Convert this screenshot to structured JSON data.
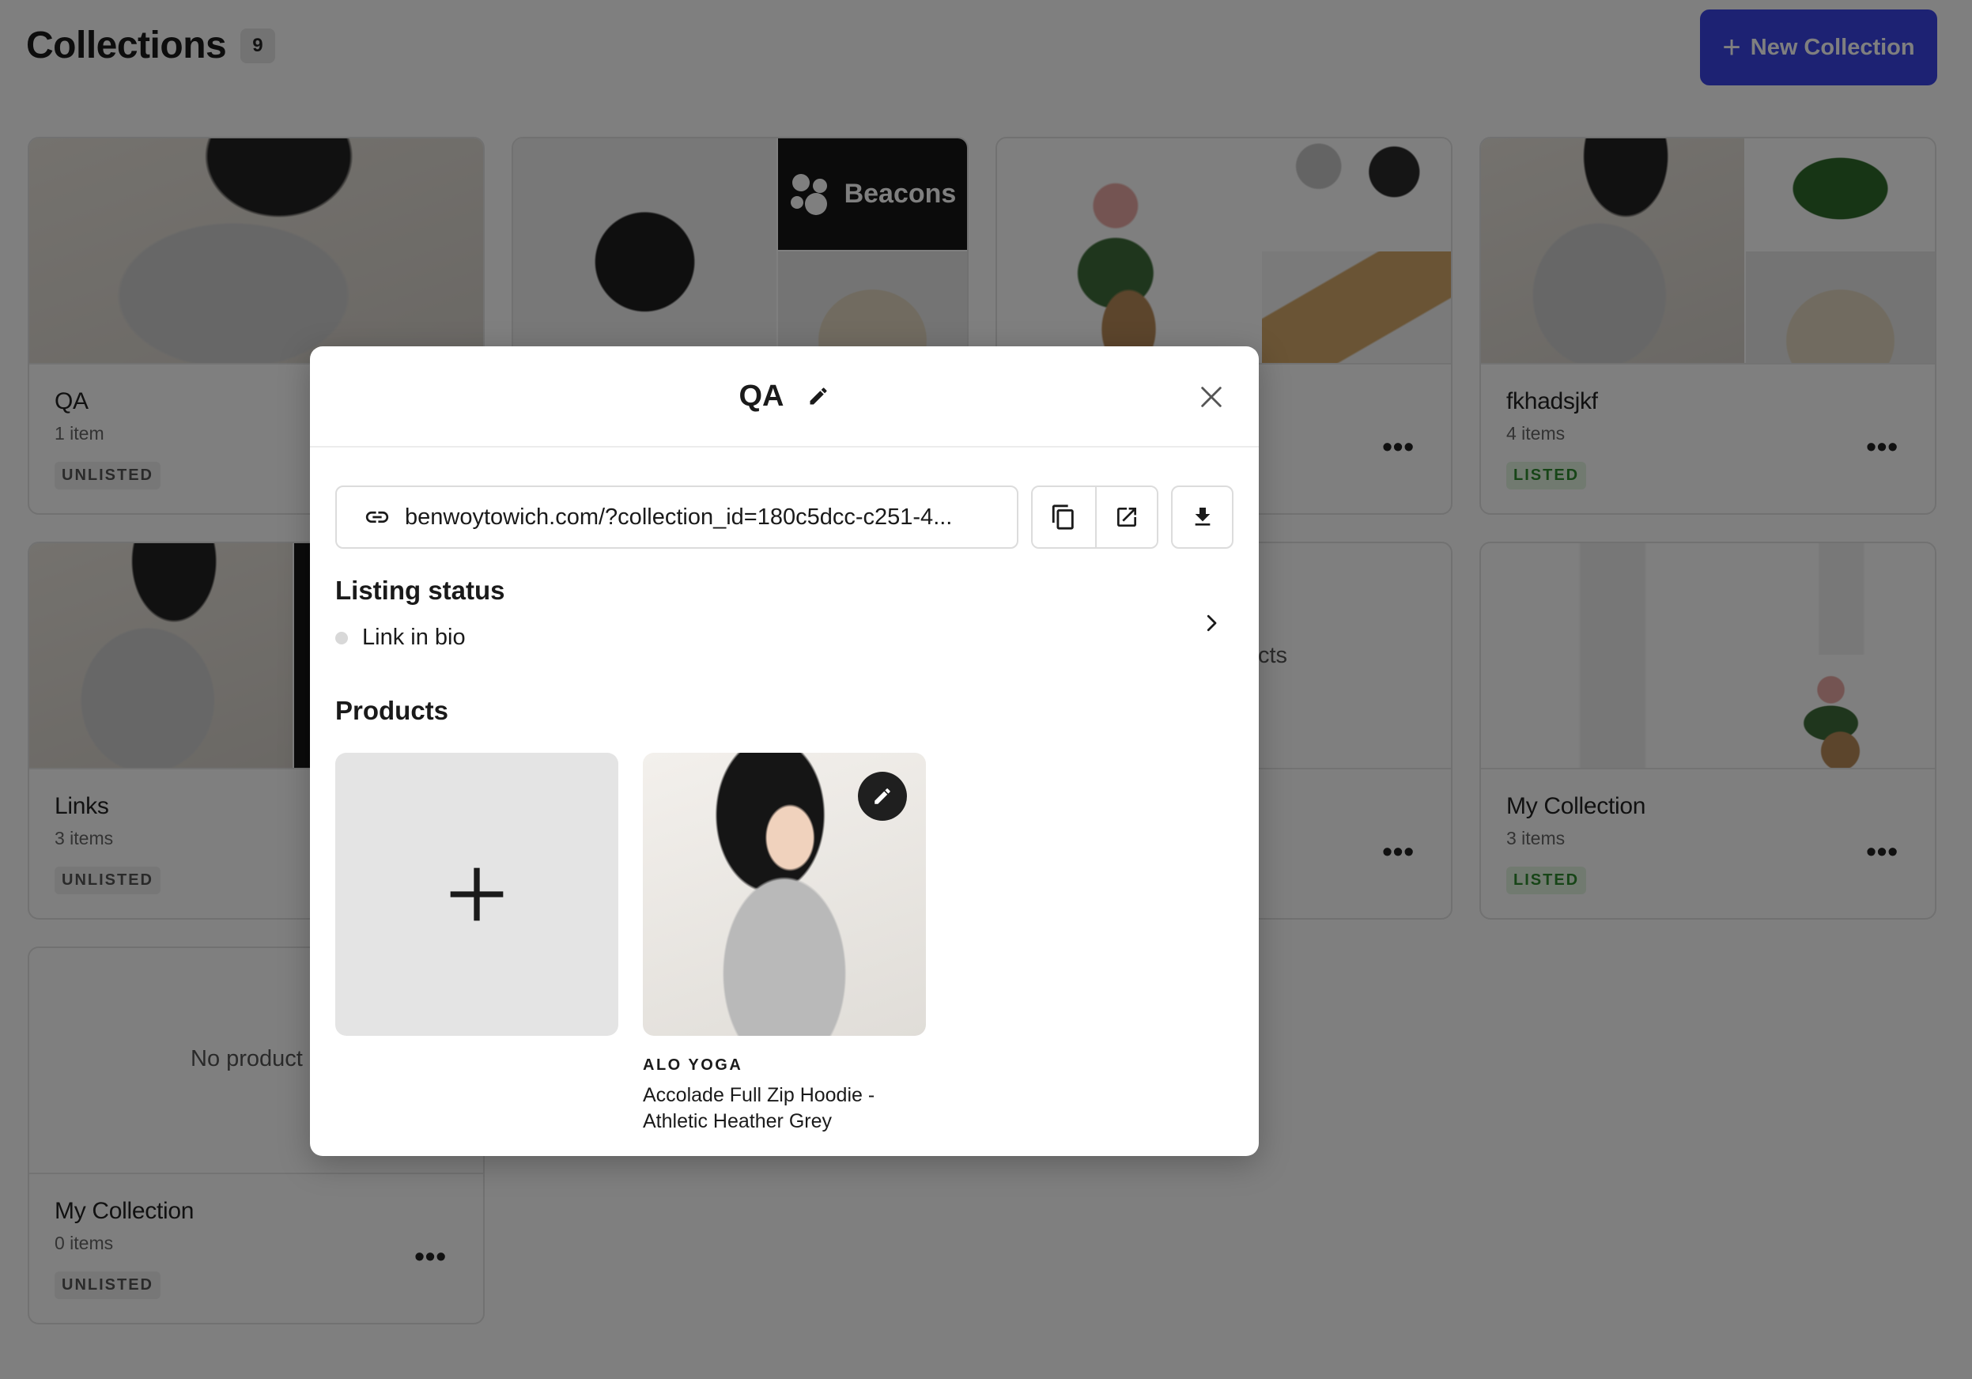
{
  "page": {
    "title": "Collections",
    "count": "9",
    "new_button_label": "New Collection"
  },
  "collections": [
    {
      "name": "QA",
      "count": "1 item",
      "status": "UNLISTED"
    },
    {
      "name": "",
      "count": "",
      "status": "",
      "thumb_text": "Beacons"
    },
    {
      "name": "",
      "count": "",
      "status": ""
    },
    {
      "name": "fkhadsjkf",
      "count": "4 items",
      "status": "LISTED"
    },
    {
      "name": "Links",
      "count": "3 items",
      "status": "UNLISTED"
    },
    {
      "name": "",
      "count": "",
      "status": "",
      "placeholder_fragment": "cts"
    },
    {
      "name": "My Collection",
      "count": "3 items",
      "status": "LISTED"
    },
    {
      "name": "My Collection",
      "count": "0 items",
      "status": "UNLISTED",
      "placeholder": "No product"
    }
  ],
  "modal": {
    "title": "QA",
    "url": "benwoytowich.com/?collection_id=180c5dcc-c251-4...",
    "listing_status_title": "Listing status",
    "listing_status_value": "Link in bio",
    "products_title": "Products",
    "products": [
      {
        "brand": "ALO YOGA",
        "name": "Accolade Full Zip Hoodie - Athletic Heather Grey"
      }
    ]
  },
  "colors": {
    "accent": "#3a44e6",
    "listed_text": "#2e8a2e",
    "listed_bg": "#e3f4e1",
    "unlisted_bg": "#eeeeee"
  },
  "icons": [
    "plus-icon",
    "pencil-icon",
    "close-icon",
    "link-icon",
    "copy-icon",
    "external-link-icon",
    "download-icon",
    "chevron-right-icon",
    "more-icon"
  ]
}
